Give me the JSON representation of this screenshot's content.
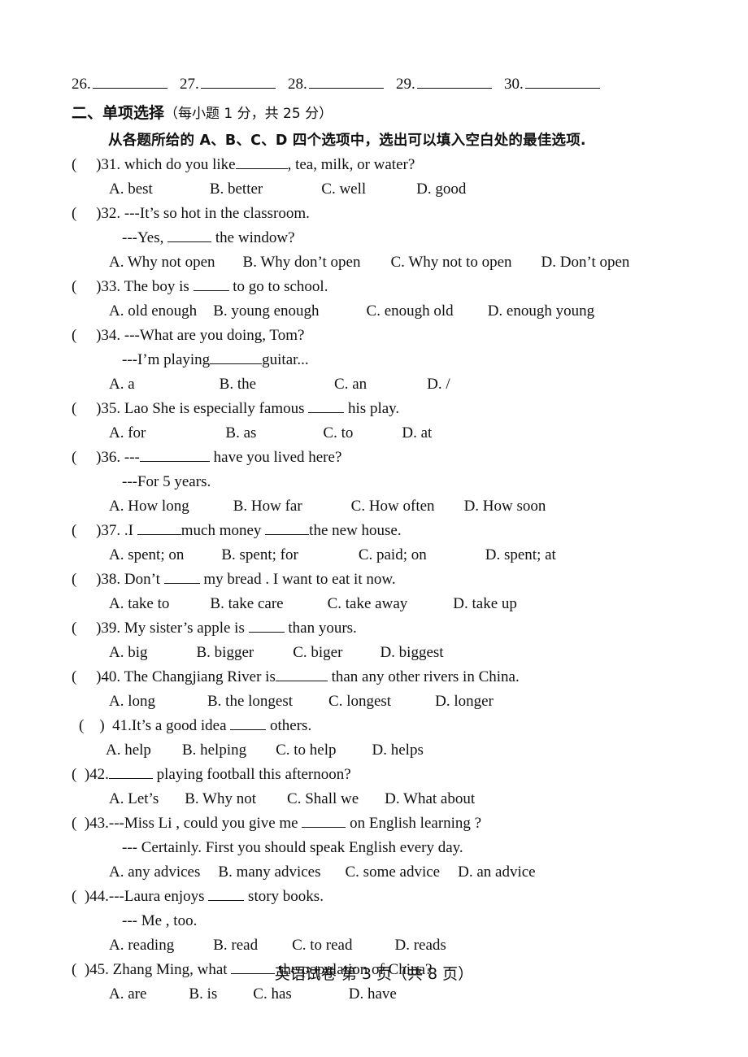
{
  "answer_row": {
    "slots": [
      {
        "num": "26."
      },
      {
        "num": "27."
      },
      {
        "num": "28."
      },
      {
        "num": "29."
      },
      {
        "num": "30."
      }
    ]
  },
  "section": {
    "title": "二、单项选择",
    "points": "（每小题 1 分，共 25 分）",
    "instruction": "从各题所给的 A、B、C、D 四个选项中，选出可以填入空白处的最佳选项."
  },
  "questions": [
    {
      "id": "31",
      "mark": "(     )31.",
      "stem_before": " which do you like",
      "blank": "b6",
      "stem_after": ", tea, milk, or water?",
      "options": [
        {
          "label": "A. best",
          "pad": 0
        },
        {
          "label": "B. better",
          "pad": 70
        },
        {
          "label": "C. well",
          "pad": 72
        },
        {
          "label": "D. good",
          "pad": 62
        }
      ]
    },
    {
      "id": "32",
      "mark": "(     )32.",
      "stem_before": " ---It’s so hot in the classroom.",
      "blank": null,
      "stem_after": "",
      "cont_before": "---Yes, ",
      "cont_blank": "b5",
      "cont_after": " the window?",
      "options": [
        {
          "label": "A. Why not open",
          "pad": 0
        },
        {
          "label": "B. Why don’t open",
          "pad": 34
        },
        {
          "label": "C. Why not to open",
          "pad": 37
        },
        {
          "label": "D. Don’t open",
          "pad": 36
        }
      ]
    },
    {
      "id": "33",
      "mark": "(     )33.",
      "stem_before": " The boy is ",
      "blank": "b4",
      "stem_after": "  to go to school.",
      "options": [
        {
          "label": "A. old enough",
          "pad": 0
        },
        {
          "label": "B. young enough",
          "pad": 20
        },
        {
          "label": "C. enough old",
          "pad": 58
        },
        {
          "label": "D. enough young",
          "pad": 42
        }
      ]
    },
    {
      "id": "34",
      "mark": "(     )34.",
      "stem_before": " ---What are you doing, Tom?",
      "blank": null,
      "stem_after": "",
      "cont_before": "---I’m playing",
      "cont_blank": "b6",
      "cont_after": "guitar...",
      "options": [
        {
          "label": "A. a",
          "pad": 0
        },
        {
          "label": "B. the",
          "pad": 104
        },
        {
          "label": "C. an",
          "pad": 96
        },
        {
          "label": "D. /",
          "pad": 74
        }
      ]
    },
    {
      "id": "35",
      "mark": "(     )35.",
      "stem_before": " Lao She is especially famous ",
      "blank": "b4",
      "stem_after": "  his play.",
      "options": [
        {
          "label": "A. for",
          "pad": 0
        },
        {
          "label": "B. as",
          "pad": 98
        },
        {
          "label": "C. to",
          "pad": 82
        },
        {
          "label": "D. at",
          "pad": 60
        }
      ]
    },
    {
      "id": "36",
      "mark": "(     )36.",
      "stem_before": " ---",
      "blank": "b8",
      "stem_after": " have you lived here?",
      "cont_before": "---For 5 years.",
      "cont_blank": null,
      "cont_after": "",
      "options": [
        {
          "label": "A. How long",
          "pad": 0
        },
        {
          "label": "B. How far",
          "pad": 54
        },
        {
          "label": "C. How often",
          "pad": 60
        },
        {
          "label": "D. How soon",
          "pad": 36
        }
      ]
    },
    {
      "id": "37",
      "mark": "(     )37.",
      "stem_before": " .I ",
      "blank": "b5",
      "stem_after": "much money ",
      "blank2": "b5",
      "stem_after2": "the new house.",
      "options": [
        {
          "label": "A. spent; on",
          "pad": 0
        },
        {
          "label": "B. spent; for",
          "pad": 46
        },
        {
          "label": "C. paid; on",
          "pad": 74
        },
        {
          "label": "D. spent; at",
          "pad": 72
        }
      ]
    },
    {
      "id": "38",
      "mark": "(     )38.",
      "stem_before": " Don’t ",
      "blank": "b4",
      "stem_after": " my bread . I want to eat it now.",
      "options": [
        {
          "label": "A. take to",
          "pad": 0
        },
        {
          "label": "B. take care",
          "pad": 50
        },
        {
          "label": "C. take away",
          "pad": 54
        },
        {
          "label": "D. take up",
          "pad": 56
        }
      ]
    },
    {
      "id": "39",
      "mark": "(     )39.",
      "stem_before": " My sister’s apple is ",
      "blank": "b4",
      "stem_after": " than yours.",
      "options": [
        {
          "label": "A. big",
          "pad": 0
        },
        {
          "label": "B. bigger",
          "pad": 60
        },
        {
          "label": "C. biger",
          "pad": 48
        },
        {
          "label": "D. biggest",
          "pad": 46
        }
      ]
    },
    {
      "id": "40",
      "mark": "(     )40.",
      "stem_before": " The Changjiang River is",
      "blank": "b6",
      "stem_after": " than any other rivers in China.",
      "options": [
        {
          "label": "A. long",
          "pad": 0
        },
        {
          "label": "B. the longest",
          "pad": 64
        },
        {
          "label": "C. longest",
          "pad": 44
        },
        {
          "label": "D. longer",
          "pad": 54
        }
      ]
    },
    {
      "id": "41",
      "mark": "(    )  41.",
      "stem_before": "It’s a good idea ",
      "blank": "b4",
      "stem_after": "  others.",
      "options": [
        {
          "label": "A. help",
          "pad": 0
        },
        {
          "label": "B. helping",
          "pad": 38
        },
        {
          "label": "C. to help",
          "pad": 36
        },
        {
          "label": "D. helps",
          "pad": 44
        }
      ]
    },
    {
      "id": "42",
      "mark": "(  )42.",
      "stem_before": "",
      "blank": "b5",
      "stem_after": " playing football this afternoon?",
      "options": [
        {
          "label": "A. Let’s",
          "pad": 0
        },
        {
          "label": "B. Why not",
          "pad": 32
        },
        {
          "label": "C. Shall we",
          "pad": 38
        },
        {
          "label": "D. What about",
          "pad": 32
        }
      ]
    },
    {
      "id": "43",
      "mark": "(  )43.",
      "stem_before": "---Miss Li , could you give me ",
      "blank": "b5",
      "stem_after": " on English learning ?",
      "cont_before": "--- Certainly. First you should speak English every day.",
      "cont_blank": null,
      "cont_after": "",
      "options": [
        {
          "label": "A. any advices",
          "pad": 0
        },
        {
          "label": "B. many advices",
          "pad": 22
        },
        {
          "label": "C. some advice",
          "pad": 30
        },
        {
          "label": "D. an advice",
          "pad": 22
        }
      ]
    },
    {
      "id": "44",
      "mark": "(  )44.",
      "stem_before": "---Laura enjoys ",
      "blank": "b4",
      "stem_after": "  story books.",
      "cont_before": "--- Me , too.",
      "cont_blank": null,
      "cont_after": "",
      "options": [
        {
          "label": "A. reading",
          "pad": 0
        },
        {
          "label": "B. read",
          "pad": 48
        },
        {
          "label": "C. to read",
          "pad": 42
        },
        {
          "label": "D. reads",
          "pad": 52
        }
      ]
    },
    {
      "id": "45",
      "mark": "(  )45.",
      "stem_before": " Zhang Ming, what ",
      "blank": "b5",
      "stem_after": "  the population of China?",
      "options": [
        {
          "label": "A. are",
          "pad": 0
        },
        {
          "label": "B. is",
          "pad": 52
        },
        {
          "label": "C. has",
          "pad": 44
        },
        {
          "label": "D. have",
          "pad": 70
        }
      ]
    }
  ],
  "footer": {
    "text": "英语试卷   第 3 页（共 8 页）"
  }
}
